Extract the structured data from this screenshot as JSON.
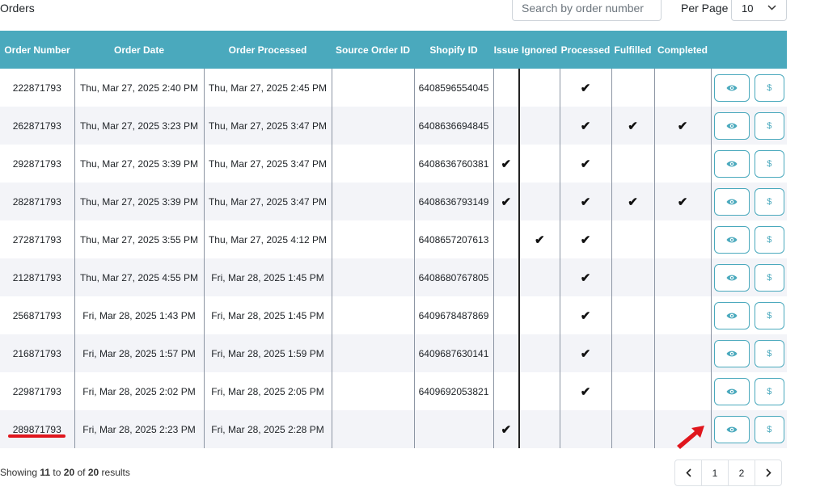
{
  "page": {
    "title": "Orders",
    "search_placeholder": "Search by order number",
    "per_page_label": "Per Page",
    "per_page_value": "10"
  },
  "table": {
    "headers": [
      "Order Number",
      "Order Date",
      "Order Processed",
      "Source Order ID",
      "Shopify ID",
      "Issue",
      "Ignored",
      "Processed",
      "Fulfilled",
      "Completed"
    ],
    "rows": [
      {
        "order_number": "222871793",
        "order_date": "Thu, Mar 27, 2025 2:40 PM",
        "order_processed": "Thu, Mar 27, 2025 2:45 PM",
        "source_order_id": "",
        "shopify_id": "6408596554045",
        "issue": "",
        "ignored": "",
        "processed": "✔",
        "fulfilled": "",
        "completed": ""
      },
      {
        "order_number": "262871793",
        "order_date": "Thu, Mar 27, 2025 3:23 PM",
        "order_processed": "Thu, Mar 27, 2025 3:47 PM",
        "source_order_id": "",
        "shopify_id": "6408636694845",
        "issue": "",
        "ignored": "",
        "processed": "✔",
        "fulfilled": "✔",
        "completed": "✔"
      },
      {
        "order_number": "292871793",
        "order_date": "Thu, Mar 27, 2025 3:39 PM",
        "order_processed": "Thu, Mar 27, 2025 3:47 PM",
        "source_order_id": "",
        "shopify_id": "6408636760381",
        "issue": "✔",
        "ignored": "",
        "processed": "✔",
        "fulfilled": "",
        "completed": ""
      },
      {
        "order_number": "282871793",
        "order_date": "Thu, Mar 27, 2025 3:39 PM",
        "order_processed": "Thu, Mar 27, 2025 3:47 PM",
        "source_order_id": "",
        "shopify_id": "6408636793149",
        "issue": "✔",
        "ignored": "",
        "processed": "✔",
        "fulfilled": "✔",
        "completed": "✔"
      },
      {
        "order_number": "272871793",
        "order_date": "Thu, Mar 27, 2025 3:55 PM",
        "order_processed": "Thu, Mar 27, 2025 4:12 PM",
        "source_order_id": "",
        "shopify_id": "6408657207613",
        "issue": "",
        "ignored": "✔",
        "processed": "✔",
        "fulfilled": "",
        "completed": ""
      },
      {
        "order_number": "212871793",
        "order_date": "Thu, Mar 27, 2025 4:55 PM",
        "order_processed": "Fri, Mar 28, 2025 1:45 PM",
        "source_order_id": "",
        "shopify_id": "6408680767805",
        "issue": "",
        "ignored": "",
        "processed": "✔",
        "fulfilled": "",
        "completed": ""
      },
      {
        "order_number": "256871793",
        "order_date": "Fri, Mar 28, 2025 1:43 PM",
        "order_processed": "Fri, Mar 28, 2025 1:45 PM",
        "source_order_id": "",
        "shopify_id": "6409678487869",
        "issue": "",
        "ignored": "",
        "processed": "✔",
        "fulfilled": "",
        "completed": ""
      },
      {
        "order_number": "216871793",
        "order_date": "Fri, Mar 28, 2025 1:57 PM",
        "order_processed": "Fri, Mar 28, 2025 1:59 PM",
        "source_order_id": "",
        "shopify_id": "6409687630141",
        "issue": "",
        "ignored": "",
        "processed": "✔",
        "fulfilled": "",
        "completed": ""
      },
      {
        "order_number": "229871793",
        "order_date": "Fri, Mar 28, 2025 2:02 PM",
        "order_processed": "Fri, Mar 28, 2025 2:05 PM",
        "source_order_id": "",
        "shopify_id": "6409692053821",
        "issue": "",
        "ignored": "",
        "processed": "✔",
        "fulfilled": "",
        "completed": ""
      },
      {
        "order_number": "289871793",
        "order_date": "Fri, Mar 28, 2025 2:23 PM",
        "order_processed": "Fri, Mar 28, 2025 2:28 PM",
        "source_order_id": "",
        "shopify_id": "",
        "issue": "✔",
        "ignored": "",
        "processed": "",
        "fulfilled": "",
        "completed": ""
      }
    ],
    "view_icon": "eye-icon",
    "pay_label": "$"
  },
  "footer": {
    "showing_prefix": "Showing",
    "from": "11",
    "to_word": "to",
    "to": "20",
    "of_word": "of",
    "total": "20",
    "results_word": "results"
  },
  "pagination": {
    "prev": "‹",
    "pages": [
      "1",
      "2"
    ],
    "next": "›"
  },
  "annotations": {
    "underline_color": "#e0161d",
    "arrow_color": "#e0161d"
  },
  "colors": {
    "header_bg": "#4aa9bd",
    "accent": "#4aa9bd"
  }
}
